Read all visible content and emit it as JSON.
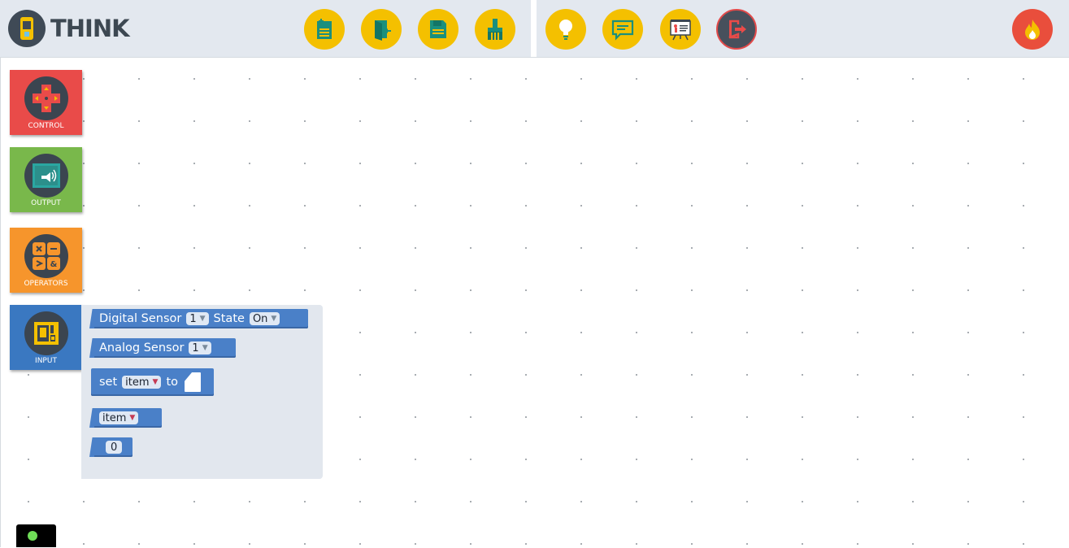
{
  "app": {
    "title": "THINK"
  },
  "toolbar": {
    "left_buttons": [
      {
        "name": "new-file"
      },
      {
        "name": "open-file"
      },
      {
        "name": "save-file"
      },
      {
        "name": "clear-workspace"
      }
    ],
    "right_buttons": [
      {
        "name": "ideas"
      },
      {
        "name": "chat"
      },
      {
        "name": "presentation"
      },
      {
        "name": "exit"
      }
    ],
    "colors": {
      "button_bg": "#f4c000",
      "header_bg": "#e3e8ef",
      "exit_bg": "#47505c",
      "fire_bg": "#e94e3c"
    }
  },
  "categories": [
    {
      "label": "CONTROL",
      "color": "#e94b49",
      "icon": "dpad-icon"
    },
    {
      "label": "OUTPUT",
      "color": "#79b84b",
      "icon": "monitor-icon"
    },
    {
      "label": "OPERATORS",
      "color": "#f6952c",
      "icon": "calculator-icon"
    },
    {
      "label": "INPUT",
      "color": "#3a78c1",
      "icon": "sensor-icon"
    }
  ],
  "flyout": {
    "digital_sensor": {
      "label": "Digital Sensor",
      "num": "1",
      "state_label": "State",
      "state": "On"
    },
    "analog_sensor": {
      "label": "Analog Sensor",
      "num": "1"
    },
    "set_block": {
      "set_label": "set",
      "var": "item",
      "to_label": "to"
    },
    "var_block": {
      "var": "item"
    },
    "number_block": {
      "value": "0"
    }
  },
  "status": {
    "indicator_color": "#6fdc57"
  }
}
